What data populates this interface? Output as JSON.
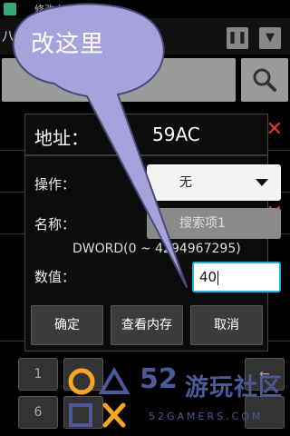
{
  "background_app": {
    "status_title": "修改内存数据",
    "app_title": "八",
    "pause_icon": "pause-icon",
    "collapse_icon": "collapse-icon",
    "search_icon": "search-icon",
    "remove_icon": "remove-icon",
    "keypad_keys": [
      "1",
      "",
      "",
      "",
      "",
      "←",
      "6",
      "",
      "",
      "",
      "",
      ""
    ]
  },
  "dialog": {
    "title_label": "地址：",
    "title_value": "59AC",
    "operation_label": "操作：",
    "operation_value": "无",
    "name_label": "名称：",
    "name_value": "搜索项1",
    "type_hint": "DWORD(0 ~ 4294967295)",
    "value_label": "数值：",
    "value": "40",
    "buttons": {
      "confirm": "确定",
      "view_memory": "查看内存",
      "cancel": "取消"
    }
  },
  "annotation": {
    "text": "改这里"
  },
  "watermark": {
    "number": "52",
    "text": "游玩社区",
    "subtext": "52GAMERS.COM"
  },
  "colors": {
    "bubble_fill": "#a8a2dc",
    "bubble_stroke": "#4a4a7a",
    "value_border": "#2ab0d8",
    "remove_red": "#e33333",
    "watermark_blue": "#4a5a9a",
    "watermark_orange": "#f5a623"
  }
}
